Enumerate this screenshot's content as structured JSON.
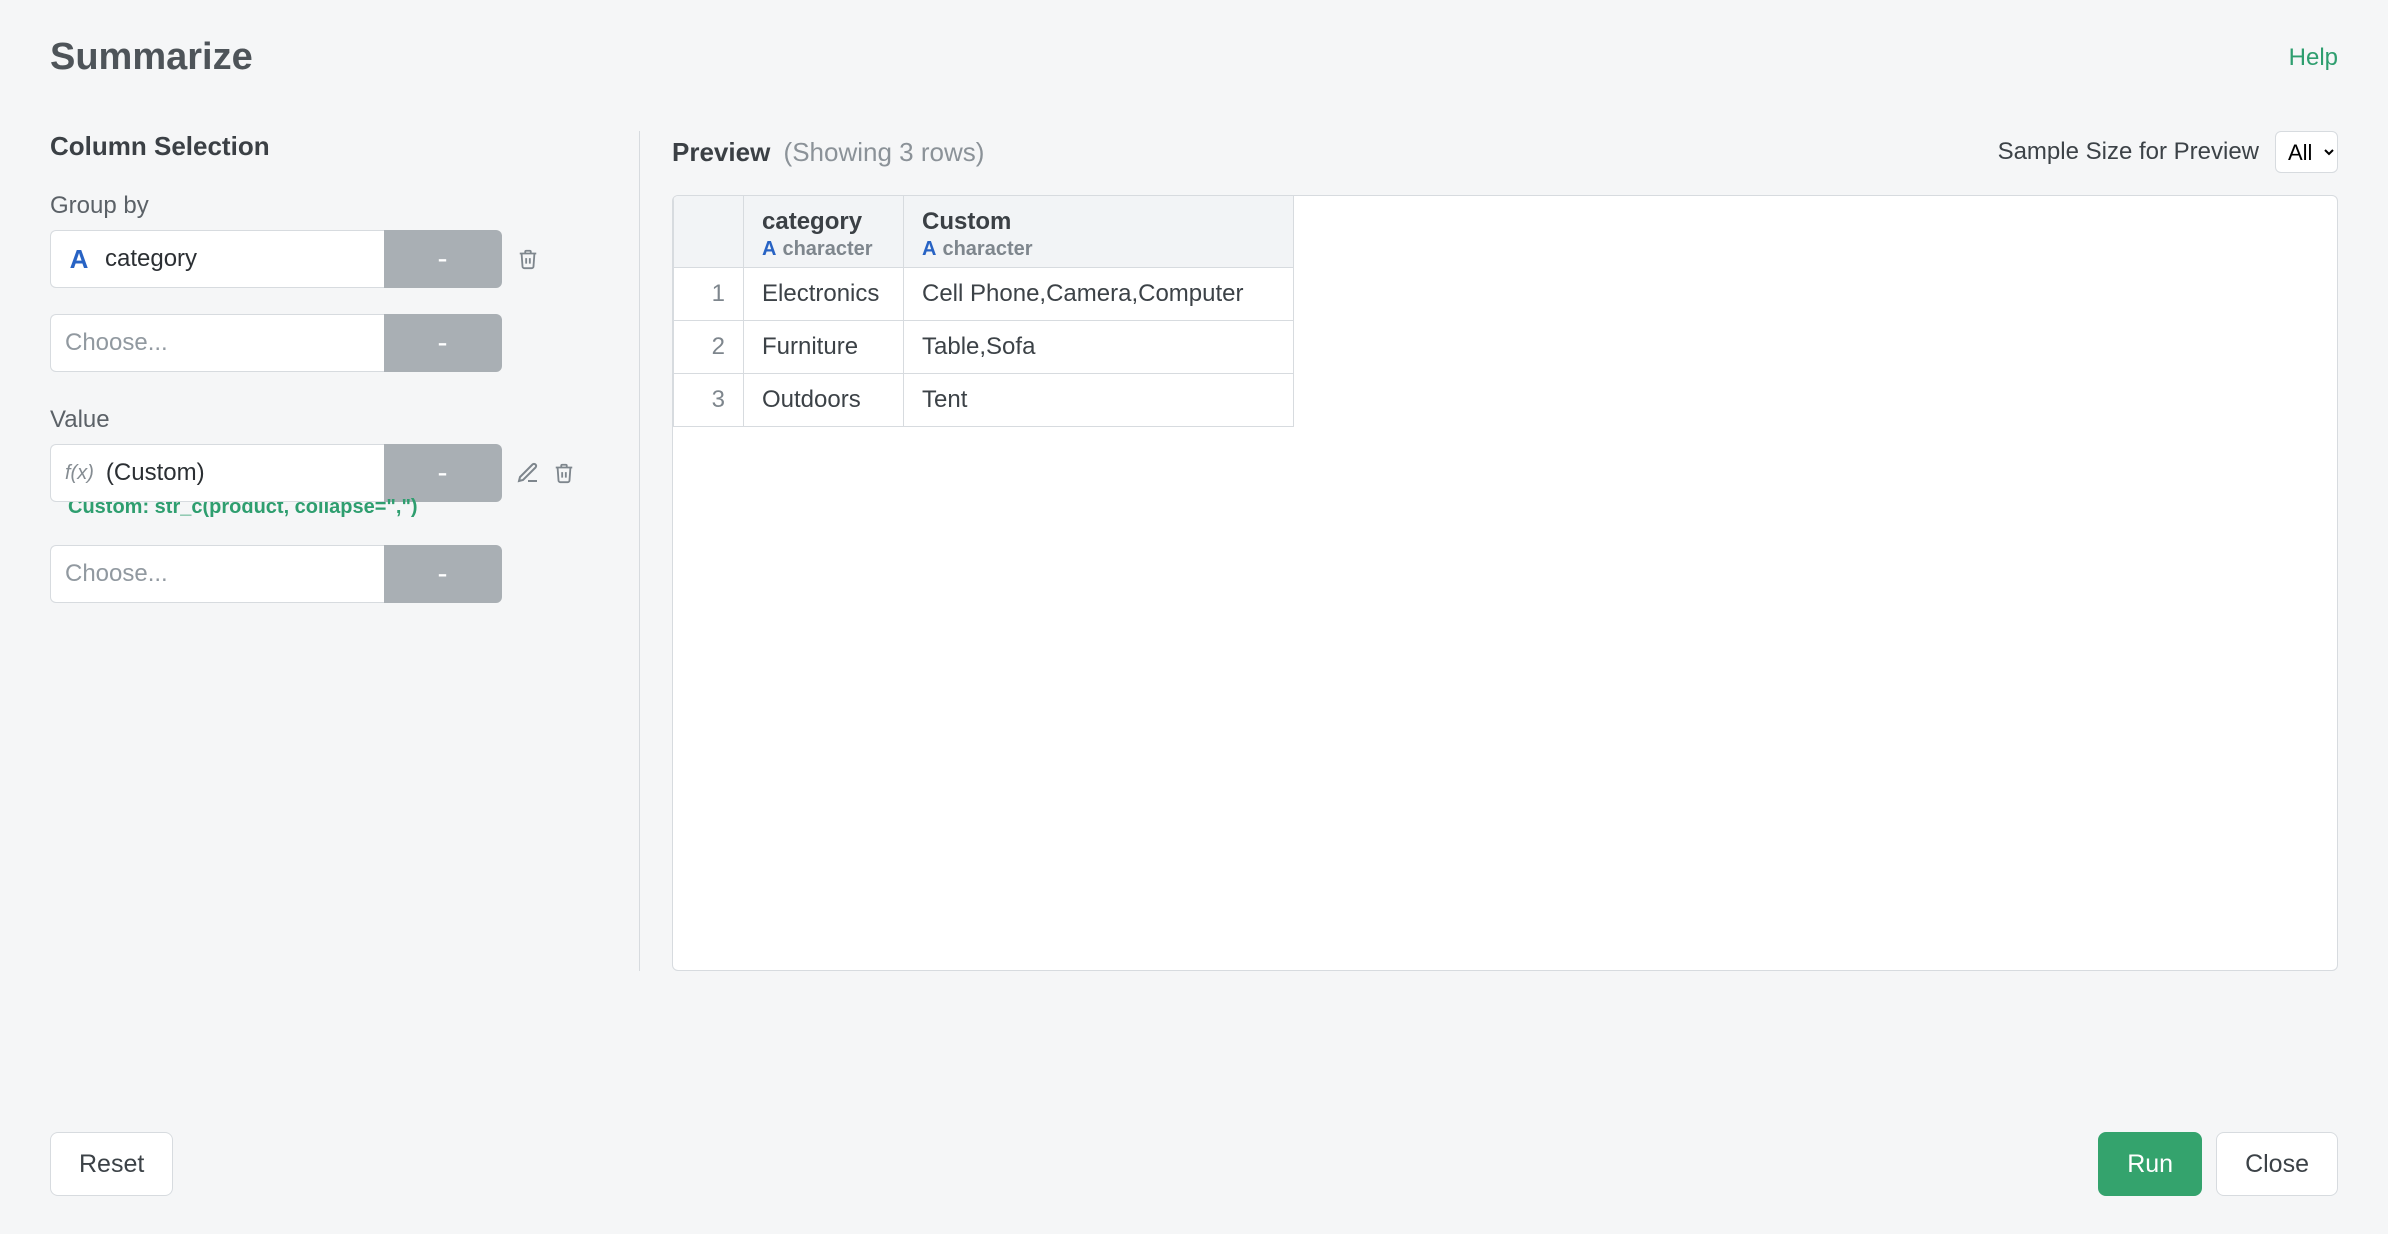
{
  "header": {
    "title": "Summarize",
    "help": "Help"
  },
  "leftPanel": {
    "sectionTitle": "Column Selection",
    "groupBy": {
      "label": "Group by",
      "rows": [
        {
          "icon": "A",
          "text": "category",
          "hasDelete": true,
          "hasEdit": false
        },
        {
          "icon": "",
          "text": "Choose...",
          "placeholder": true
        }
      ]
    },
    "value": {
      "label": "Value",
      "rows": [
        {
          "icon": "fx",
          "text": "(Custom)",
          "hasDelete": true,
          "hasEdit": true,
          "exprLabel": "Custom: str_c(product, collapse=\",\")"
        },
        {
          "icon": "",
          "text": "Choose...",
          "placeholder": true
        }
      ]
    },
    "dashButton": "-"
  },
  "preview": {
    "title": "Preview",
    "subtitle": "(Showing 3 rows)",
    "sampleLabel": "Sample Size for Preview",
    "sampleSelected": "All",
    "columns": [
      {
        "name": "category",
        "typeLabel": "character"
      },
      {
        "name": "Custom",
        "typeLabel": "character"
      }
    ],
    "rows": [
      {
        "idx": "1",
        "cells": [
          "Electronics",
          "Cell Phone,Camera,Computer"
        ]
      },
      {
        "idx": "2",
        "cells": [
          "Furniture",
          "Table,Sofa"
        ]
      },
      {
        "idx": "3",
        "cells": [
          "Outdoors",
          "Tent"
        ]
      }
    ]
  },
  "footer": {
    "reset": "Reset",
    "run": "Run",
    "close": "Close"
  }
}
